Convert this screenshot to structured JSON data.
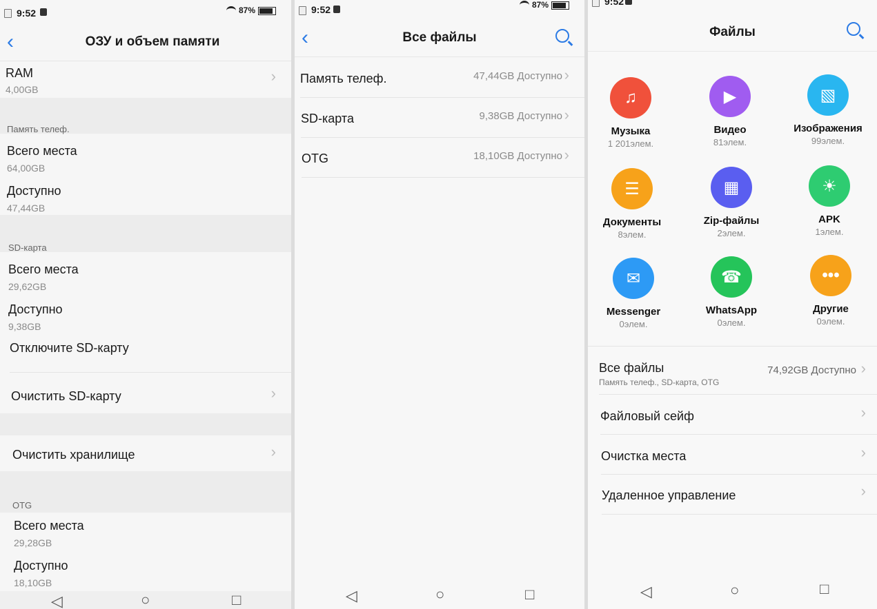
{
  "status": {
    "time": "9:52",
    "battery": "87%"
  },
  "screen1": {
    "title": "ОЗУ и объем памяти",
    "ram": {
      "label": "RAM",
      "value": "4,00GB"
    },
    "phone_section": "Память телеф.",
    "phone_total": {
      "label": "Всего места",
      "value": "64,00GB"
    },
    "phone_avail": {
      "label": "Доступно",
      "value": "47,44GB"
    },
    "sd_section": "SD-карта",
    "sd_total": {
      "label": "Всего места",
      "value": "29,62GB"
    },
    "sd_avail": {
      "label": "Доступно",
      "value": "9,38GB"
    },
    "unmount_sd": "Отключите SD-карту",
    "clear_sd": "Очистить SD-карту",
    "clear_storage": "Очистить хранилище",
    "otg_section": "OTG",
    "otg_total": {
      "label": "Всего места",
      "value": "29,28GB"
    },
    "otg_avail": {
      "label": "Доступно",
      "value": "18,10GB"
    }
  },
  "screen2": {
    "title": "Все файлы",
    "items": [
      {
        "label": "Память телеф.",
        "value": "47,44GB Доступно"
      },
      {
        "label": "SD-карта",
        "value": "9,38GB Доступно"
      },
      {
        "label": "OTG",
        "value": "18,10GB Доступно"
      }
    ]
  },
  "screen3": {
    "title": "Файлы",
    "categories": [
      {
        "name": "Музыка",
        "count": "1 201элем.",
        "icon": "music-note-icon",
        "color": "#f0513b"
      },
      {
        "name": "Видео",
        "count": "81элем.",
        "icon": "play-icon",
        "color": "#a05cf0"
      },
      {
        "name": "Изображения",
        "count": "99элем.",
        "icon": "image-icon",
        "color": "#29b6f0"
      },
      {
        "name": "Документы",
        "count": "8элем.",
        "icon": "document-icon",
        "color": "#f7a21a"
      },
      {
        "name": "Zip-файлы",
        "count": "2элем.",
        "icon": "zip-icon",
        "color": "#5a5ef0"
      },
      {
        "name": "APK",
        "count": "1элем.",
        "icon": "android-icon",
        "color": "#2ecc71"
      },
      {
        "name": "Messenger",
        "count": "0элем.",
        "icon": "messenger-icon",
        "color": "#2d9af5"
      },
      {
        "name": "WhatsApp",
        "count": "0элем.",
        "icon": "whatsapp-icon",
        "color": "#25c45a"
      },
      {
        "name": "Другие",
        "count": "0элем.",
        "icon": "more-icon",
        "color": "#f7a21a"
      }
    ],
    "all_files": {
      "label": "Все файлы",
      "sub": "Память телеф., SD-карта, OTG",
      "value": "74,92GB Доступно"
    },
    "safe": "Файловый сейф",
    "cleanup": "Очистка места",
    "remote": "Удаленное управление"
  }
}
